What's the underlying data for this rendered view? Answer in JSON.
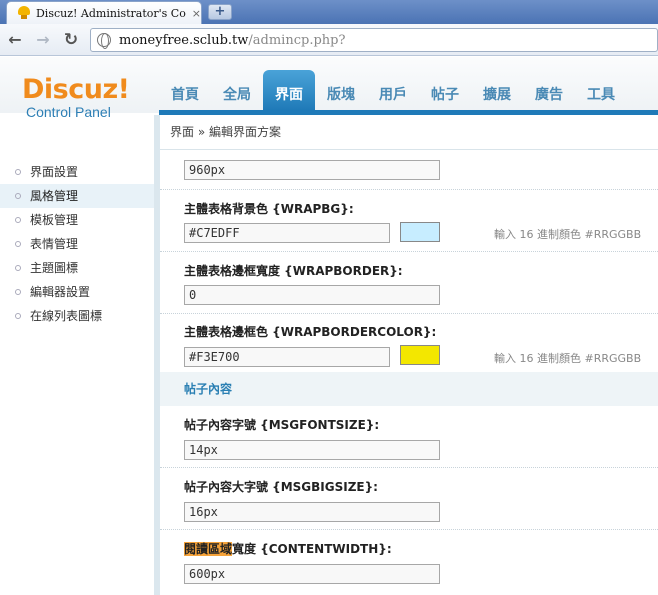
{
  "browser": {
    "tab_title": "Discuz! Administrator's Contro",
    "tab_close": "×",
    "newtab_label": "+",
    "url_host": "moneyfree.sclub.tw",
    "url_path": "/admincp.php?"
  },
  "logo": {
    "main": "Discuz!",
    "sub": "Control Panel"
  },
  "nav": [
    {
      "label": "首頁"
    },
    {
      "label": "全局"
    },
    {
      "label": "界面",
      "active": true
    },
    {
      "label": "版塊"
    },
    {
      "label": "用戶"
    },
    {
      "label": "帖子"
    },
    {
      "label": "擴展"
    },
    {
      "label": "廣告"
    },
    {
      "label": "工具"
    }
  ],
  "breadcrumb": "界面 » 編輯界面方案",
  "sidebar": {
    "items": [
      {
        "label": "界面設置"
      },
      {
        "label": "風格管理"
      },
      {
        "label": "模板管理"
      },
      {
        "label": "表情管理"
      },
      {
        "label": "主題圖標"
      },
      {
        "label": "編輯器設置"
      },
      {
        "label": "在線列表圖標"
      }
    ]
  },
  "form": {
    "width_value": "960px",
    "wrapbg": {
      "label": "主體表格背景色 {WRAPBG}:",
      "value": "#C7EDFF",
      "color": "#C7EDFF",
      "hint": "輸入 16 進制顏色 #RRGGBB"
    },
    "wrapborder": {
      "label": "主體表格邊框寬度 {WRAPBORDER}:",
      "value": "0"
    },
    "wrapbordercolor": {
      "label": "主體表格邊框色 {WRAPBORDERCOLOR}:",
      "value": "#F3E700",
      "color": "#F3E700",
      "hint": "輸入 16 進制顏色 #RRGGBB"
    },
    "section_title": "帖子內容",
    "msgfontsize": {
      "label": "帖子內容字號 {MSGFONTSIZE}:",
      "value": "14px"
    },
    "msgbigsize": {
      "label": "帖子內容大字號 {MSGBIGSIZE}:",
      "value": "16px"
    },
    "contentwidth": {
      "label_highlight": "閱讀區域",
      "label_rest": "寬度 {CONTENTWIDTH}:",
      "value": "600px"
    }
  },
  "colors": {
    "accent": "#1f7ab8",
    "logo_orange": "#f08b1d",
    "highlight": "#f6a33a"
  }
}
